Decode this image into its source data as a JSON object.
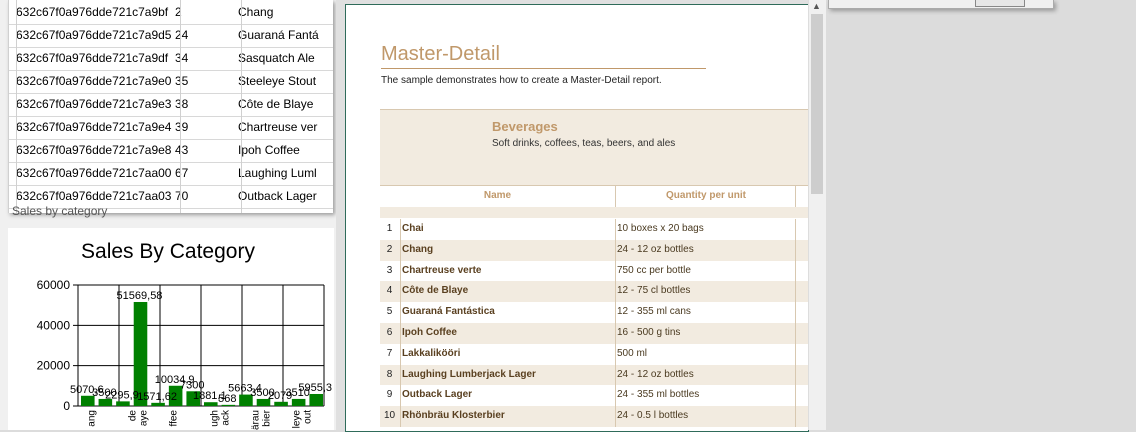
{
  "grid": {
    "rows": [
      {
        "id": "632c67f0a976dde721c7a9bf",
        "num": "2",
        "name": "Chang"
      },
      {
        "id": "632c67f0a976dde721c7a9d5",
        "num": "24",
        "name": "Guaraná Fantá"
      },
      {
        "id": "632c67f0a976dde721c7a9df",
        "num": "34",
        "name": "Sasquatch Ale"
      },
      {
        "id": "632c67f0a976dde721c7a9e0",
        "num": "35",
        "name": "Steeleye Stout"
      },
      {
        "id": "632c67f0a976dde721c7a9e3",
        "num": "38",
        "name": "Côte de Blaye"
      },
      {
        "id": "632c67f0a976dde721c7a9e4",
        "num": "39",
        "name": "Chartreuse ver"
      },
      {
        "id": "632c67f0a976dde721c7a9e8",
        "num": "43",
        "name": "Ipoh Coffee"
      },
      {
        "id": "632c67f0a976dde721c7aa00",
        "num": "67",
        "name": "Laughing Luml"
      },
      {
        "id": "632c67f0a976dde721c7aa03",
        "num": "70",
        "name": "Outback Lager"
      }
    ]
  },
  "sales_caption": "Sales by category",
  "chart_data": {
    "type": "bar",
    "title": "Sales By Category",
    "ylim": [
      0,
      60000
    ],
    "yticks": [
      "60000",
      "40000",
      "20000",
      "0"
    ],
    "bar_color": "#008000",
    "values": [
      5070.6,
      3500,
      2295.9,
      51569.58,
      1571.62,
      10034.9,
      7300,
      1881.1,
      568,
      5663.4,
      3500,
      2079,
      3510,
      5955.3
    ],
    "data_labels": [
      "5070,6",
      "3500",
      "2295,9",
      "51569,58",
      "1571,62",
      "10034,9",
      "7300",
      "1881,1",
      "568",
      "5663,4",
      "3500",
      "2079",
      "3510",
      "5955,3"
    ],
    "x_tick_labels": [
      "ang",
      "de\naye",
      "ffee",
      "ugh\nack",
      "ärau\nbier",
      "leye\nout"
    ]
  },
  "report": {
    "title": "Master-Detail",
    "subtitle": "The sample demonstrates how to create a Master-Detail report.",
    "category_name": "Beverages",
    "category_desc": "Soft drinks, coffees, teas, beers, and ales",
    "col_name": "Name",
    "col_qty": "Quantity per unit",
    "rows": [
      {
        "n": "1",
        "name": "Chai",
        "qty": "10 boxes x 20 bags"
      },
      {
        "n": "2",
        "name": "Chang",
        "qty": "24 - 12 oz bottles"
      },
      {
        "n": "3",
        "name": "Chartreuse verte",
        "qty": "750 cc per bottle"
      },
      {
        "n": "4",
        "name": "Côte de Blaye",
        "qty": "12 - 75 cl bottles"
      },
      {
        "n": "5",
        "name": "Guaraná Fantástica",
        "qty": "12 - 355 ml cans"
      },
      {
        "n": "6",
        "name": "Ipoh Coffee",
        "qty": "16 - 500 g tins"
      },
      {
        "n": "7",
        "name": "Lakkalikööri",
        "qty": "500 ml"
      },
      {
        "n": "8",
        "name": "Laughing Lumberjack Lager",
        "qty": "24 - 12 oz bottles"
      },
      {
        "n": "9",
        "name": "Outback Lager",
        "qty": "24 - 355 ml bottles"
      },
      {
        "n": "10",
        "name": "Rhönbräu Klosterbier",
        "qty": "24 - 0.5 l bottles"
      }
    ],
    "band_color": "#f2ebe0",
    "accent_color": "#c0986a"
  },
  "icons": {
    "scroll_up": "chevron-up-icon"
  }
}
